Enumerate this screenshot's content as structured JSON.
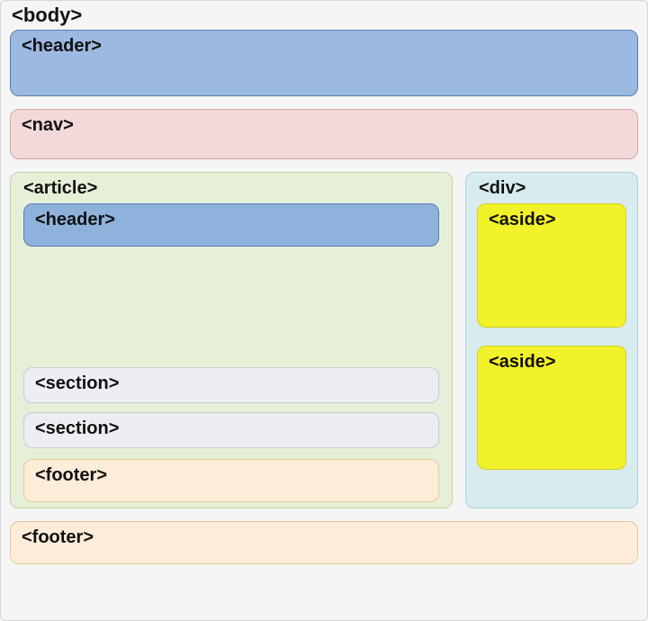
{
  "body_label": "<body>",
  "header_top": "<header>",
  "nav": "<nav>",
  "article": {
    "label": "<article>",
    "header": "<header>",
    "sections": [
      "<section>",
      "<section>"
    ],
    "footer": "<footer>"
  },
  "sidebar": {
    "label": "<div>",
    "asides": [
      "<aside>",
      "<aside>"
    ]
  },
  "footer_bottom": "<footer>"
}
